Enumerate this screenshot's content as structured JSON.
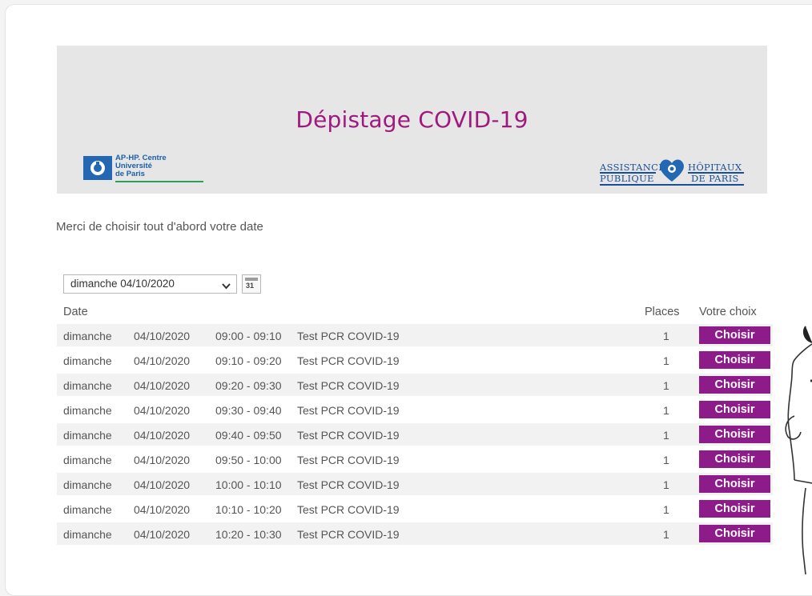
{
  "banner": {
    "title": "Dépistage COVID-19",
    "logo_left": {
      "line1": "AP-HP. Centre",
      "line2": "Université",
      "line3": "de Paris"
    },
    "logo_right": {
      "w1": "ASSISTANCE",
      "w2": "PUBLIQUE",
      "w3": "HÔPITAUX",
      "w4": "DE PARIS"
    }
  },
  "intro": "Merci de choisir tout d'abord votre date",
  "date_select": {
    "value": "dimanche 04/10/2020"
  },
  "calendar_icon_text": "31",
  "table": {
    "headers": {
      "date": "Date",
      "places": "Places",
      "choice": "Votre choix"
    },
    "button_label": "Choisir",
    "rows": [
      {
        "day": "dimanche",
        "date": "04/10/2020",
        "time": "09:00 - 09:10",
        "test": "Test PCR COVID-19",
        "places": "1"
      },
      {
        "day": "dimanche",
        "date": "04/10/2020",
        "time": "09:10 - 09:20",
        "test": "Test PCR COVID-19",
        "places": "1"
      },
      {
        "day": "dimanche",
        "date": "04/10/2020",
        "time": "09:20 - 09:30",
        "test": "Test PCR COVID-19",
        "places": "1"
      },
      {
        "day": "dimanche",
        "date": "04/10/2020",
        "time": "09:30 - 09:40",
        "test": "Test PCR COVID-19",
        "places": "1"
      },
      {
        "day": "dimanche",
        "date": "04/10/2020",
        "time": "09:40 - 09:50",
        "test": "Test PCR COVID-19",
        "places": "1"
      },
      {
        "day": "dimanche",
        "date": "04/10/2020",
        "time": "09:50 - 10:00",
        "test": "Test PCR COVID-19",
        "places": "1"
      },
      {
        "day": "dimanche",
        "date": "04/10/2020",
        "time": "10:00 - 10:10",
        "test": "Test PCR COVID-19",
        "places": "1"
      },
      {
        "day": "dimanche",
        "date": "04/10/2020",
        "time": "10:10 - 10:20",
        "test": "Test PCR COVID-19",
        "places": "1"
      },
      {
        "day": "dimanche",
        "date": "04/10/2020",
        "time": "10:20 - 10:30",
        "test": "Test PCR COVID-19",
        "places": "1"
      }
    ]
  },
  "colors": {
    "brand": "#a0197f",
    "button": "#8e1b8a",
    "banner_bg": "#e6e6e6",
    "logo_blue": "#2468b4"
  }
}
